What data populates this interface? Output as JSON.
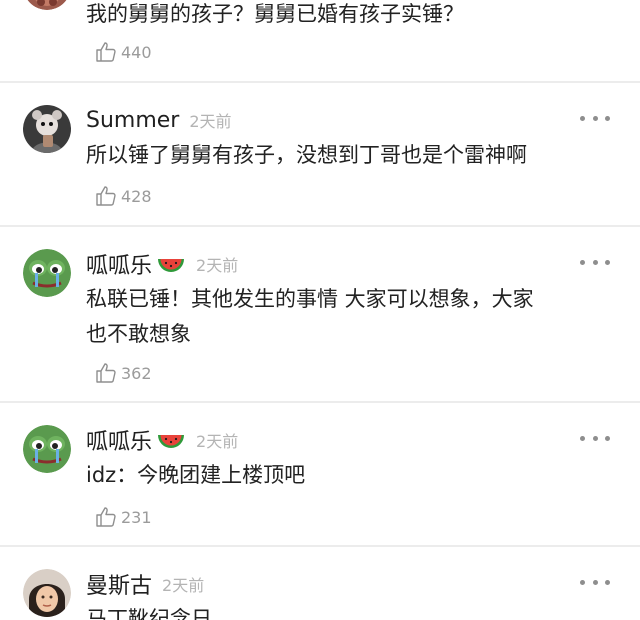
{
  "comments": [
    {
      "text": "我的舅舅的孩子？舅舅已婚有孩子实锤？",
      "likes": "440"
    },
    {
      "author": "Summer",
      "time": "2天前",
      "text": "所以锤了舅舅有孩子，没想到丁哥也是个雷神啊",
      "likes": "428"
    },
    {
      "author": "呱呱乐",
      "time": "2天前",
      "text": "私联已锤！其他发生的事情 大家可以想象，大家\n也不敢想象",
      "likes": "362",
      "emoji": "watermelon-emoji"
    },
    {
      "author": "呱呱乐",
      "time": "2天前",
      "text": "idz：今晚团建上楼顶吧",
      "likes": "231",
      "emoji": "watermelon-emoji"
    },
    {
      "author": "曼斯古",
      "time": "2天前",
      "text": "马丁靴纪念日"
    }
  ],
  "icons": {
    "like": "thumbs-up-icon",
    "more": "more-dots-icon"
  },
  "colors": {
    "text": "#222222",
    "meta": "#b4b4b4",
    "count": "#9b9b9b",
    "divider": "#ececec"
  }
}
